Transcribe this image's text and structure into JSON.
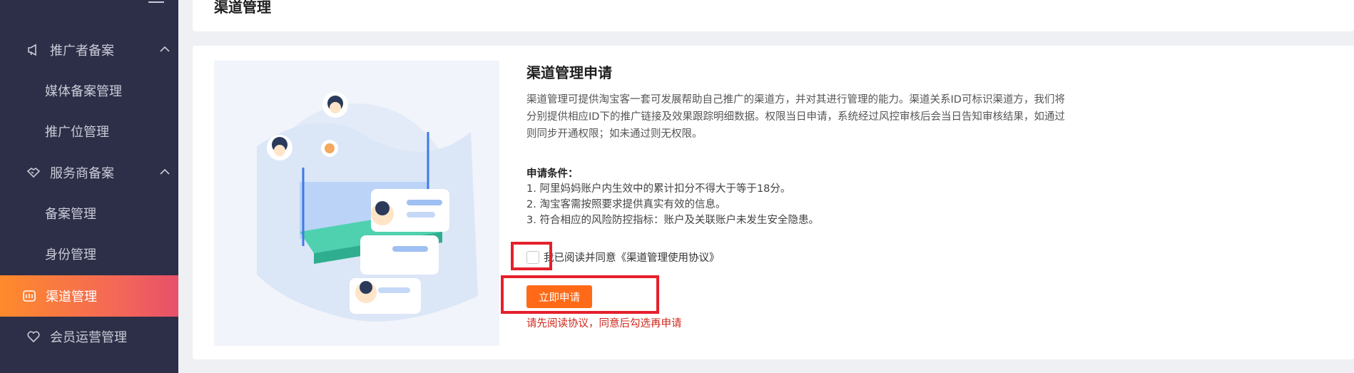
{
  "sidebar": {
    "groups": [
      {
        "label": "推广者备案",
        "icon": "megaphone-icon"
      },
      {
        "label": "服务商备案",
        "icon": "handshake-icon"
      }
    ],
    "subitems": [
      {
        "label": "媒体备案管理"
      },
      {
        "label": "推广位管理"
      },
      {
        "label": "备案管理"
      },
      {
        "label": "身份管理"
      }
    ],
    "active": {
      "label": "渠道管理",
      "icon": "channel-icon"
    },
    "bottom": {
      "label": "会员运营管理",
      "icon": "heart-icon"
    }
  },
  "header": {
    "title": "渠道管理"
  },
  "main": {
    "title": "渠道管理申请",
    "description": "渠道管理可提供淘宝客一套可发展帮助自己推广的渠道方，并对其进行管理的能力。渠道关系ID可标识渠道方，我们将分别提供相应ID下的推广链接及效果跟踪明细数据。权限当日申请，系统经过风控审核后会当日告知审核结果，如通过则同步开通权限；如未通过则无权限。",
    "conditions_title": "申请条件：",
    "conditions": [
      "1. 阿里妈妈账户内生效中的累计扣分不得大于等于18分。",
      "2. 淘宝客需按照要求提供真实有效的信息。",
      "3. 符合相应的风险防控指标：账户及关联账户未发生安全隐患。"
    ],
    "agree_text": "我已阅读并同意《渠道管理使用协议》",
    "apply_label": "立即申请",
    "error_text": "请先阅读协议，同意后勾选再申请"
  },
  "colors": {
    "accent": "#ff6a18",
    "sidebar_bg": "#2d2f48",
    "highlight": "#e5202b",
    "error": "#d0281d"
  }
}
